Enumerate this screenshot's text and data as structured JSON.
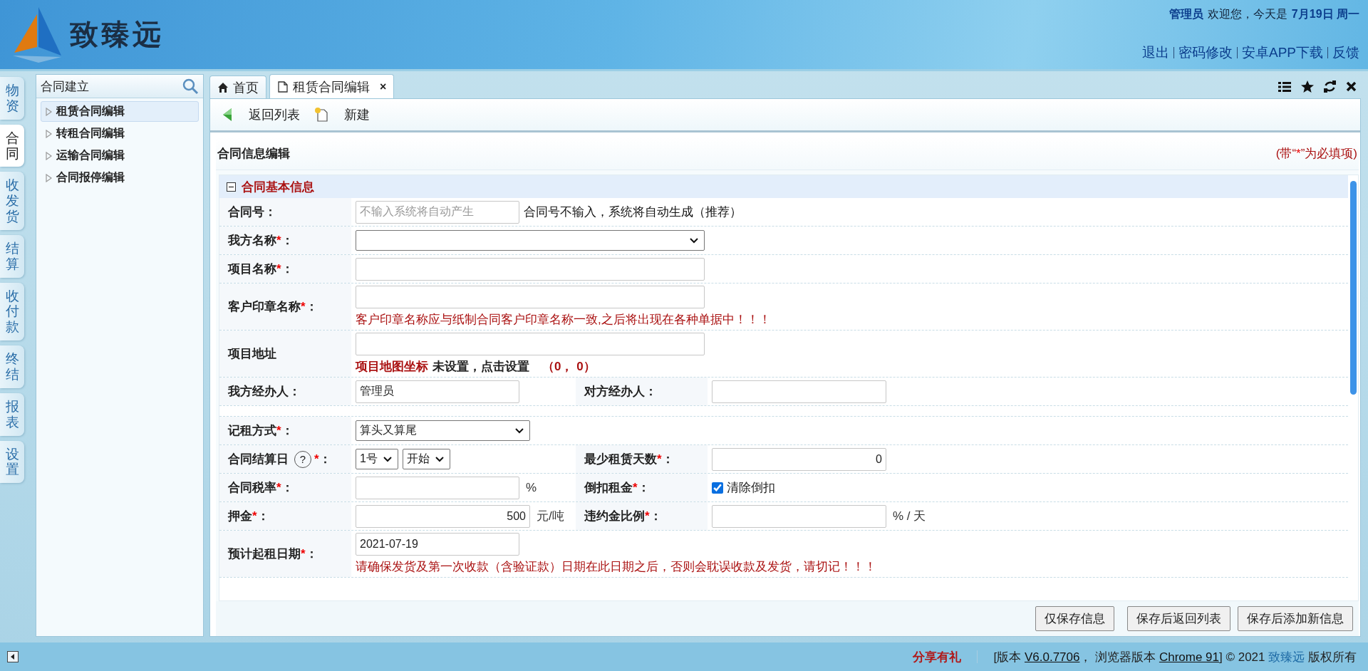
{
  "header": {
    "logo": "致臻远",
    "user": "管理员",
    "greeting": "欢迎您，今天是",
    "date": "7月19日 周一",
    "links": [
      "退出",
      "密码修改",
      "安卓APP下载",
      "反馈"
    ]
  },
  "module_tabs": [
    {
      "label": "物资",
      "selected": false
    },
    {
      "label": "合同",
      "selected": true
    },
    {
      "label": "收发货",
      "selected": false
    },
    {
      "label": "结算",
      "selected": false
    },
    {
      "label": "收付款",
      "selected": false
    },
    {
      "label": "终结",
      "selected": false
    },
    {
      "label": "报表",
      "selected": false
    },
    {
      "label": "设置",
      "selected": false
    }
  ],
  "sidebar": {
    "search": {
      "value": "合同建立"
    },
    "items": [
      {
        "label": "租赁合同编辑",
        "selected": true
      },
      {
        "label": "转租合同编辑",
        "selected": false
      },
      {
        "label": "运输合同编辑",
        "selected": false
      },
      {
        "label": "合同报停编辑",
        "selected": false
      }
    ]
  },
  "tabs": [
    {
      "label": "首页",
      "kind": "home",
      "selected": false
    },
    {
      "label": "租赁合同编辑",
      "kind": "page",
      "selected": true,
      "close": "×"
    }
  ],
  "toolbar": [
    {
      "label": "返回列表",
      "kind": "back"
    },
    {
      "label": "新建",
      "kind": "new"
    }
  ],
  "form": {
    "title": "合同信息编辑",
    "note": {
      "before": "(带“",
      "mark": "*",
      "after": "”为必填项)"
    },
    "section": {
      "title": "合同基本信息",
      "expanded": true
    },
    "rows": [
      {
        "cells": [
          {
            "label": "合同号",
            "suffix": "：",
            "controls": [
              {
                "kind": "input",
                "placeholder": "不输入系统将自动产生"
              }
            ],
            "after": [
              {
                "kind": "hint",
                "text": "合同号不输入，系统将自动生成（推荐）"
              }
            ]
          }
        ]
      },
      {
        "cells": [
          {
            "label": "我方名称",
            "mark": "*",
            "suffix": "：",
            "controls": [
              {
                "kind": "select"
              }
            ]
          }
        ]
      },
      {
        "cells": [
          {
            "label": "项目名称",
            "mark": "*",
            "suffix": "：",
            "controls": [
              {
                "kind": "input"
              }
            ]
          }
        ]
      },
      {
        "cells": [
          {
            "label": "客户印章名称",
            "mark": "*",
            "suffix": "：",
            "controls": [
              {
                "kind": "input"
              }
            ],
            "below": [
              {
                "kind": "warning",
                "text": "客户印章名称应与纸制合同客户印章名称一致,之后将出现在各种单据中！！！"
              }
            ]
          }
        ]
      },
      {
        "cells": [
          {
            "label": "项目地址",
            "controls": [
              {
                "kind": "input"
              }
            ],
            "below": [
              {
                "kind": "map-link",
                "text": "项目地图坐标"
              },
              {
                "kind": "status",
                "text": "未设置，点击设置"
              },
              {
                "kind": "coords",
                "text": "（0， 0）"
              }
            ]
          }
        ]
      },
      {
        "cells": [
          {
            "label": "我方经办人",
            "suffix": "：",
            "controls": [
              {
                "kind": "input",
                "value": "管理员"
              }
            ]
          },
          {
            "label": "对方经办人",
            "suffix": "：",
            "controls": [
              {
                "kind": "input"
              }
            ]
          }
        ]
      },
      {
        "cells": [
          {
            "label": "记租方式",
            "mark": "*",
            "suffix": "：",
            "controls": [
              {
                "kind": "select",
                "value": "算头又算尾"
              }
            ]
          }
        ]
      },
      {
        "cells": [
          {
            "label": "合同结算日",
            "help": "?",
            "mark": "*",
            "suffix": "：",
            "controls": [
              {
                "kind": "select",
                "value": "1号"
              },
              {
                "kind": "select",
                "value": "开始"
              }
            ]
          },
          {
            "label": "最少租赁天数",
            "mark": "*",
            "suffix": "：",
            "controls": [
              {
                "kind": "number",
                "value": "0"
              }
            ]
          }
        ]
      },
      {
        "cells": [
          {
            "label": "合同税率",
            "mark": "*",
            "suffix": "：",
            "controls": [
              {
                "kind": "input"
              }
            ],
            "after": [
              {
                "kind": "unit",
                "text": "%"
              }
            ]
          },
          {
            "label": "倒扣租金",
            "mark": "*",
            "suffix": "：",
            "controls": [
              {
                "kind": "checkbox",
                "checked": true,
                "label": "清除倒扣"
              }
            ]
          }
        ]
      },
      {
        "cells": [
          {
            "label": "押金",
            "mark": "*",
            "suffix": "：",
            "controls": [
              {
                "kind": "number",
                "value": "500"
              }
            ],
            "after": [
              {
                "kind": "unit",
                "text": "元/吨"
              }
            ]
          },
          {
            "label": "违约金比例",
            "mark": "*",
            "suffix": "：",
            "controls": [
              {
                "kind": "input"
              }
            ],
            "after": [
              {
                "kind": "unit",
                "text": "% / 天"
              }
            ]
          }
        ]
      },
      {
        "cells": [
          {
            "label": "预计起租日期",
            "mark": "*",
            "suffix": "：",
            "controls": [
              {
                "kind": "input",
                "value": "2021-07-19"
              }
            ],
            "below": [
              {
                "kind": "warning",
                "text": "请确保发货及第一次收款（含验证款）日期在此日期之后，否则会耽误收款及发货，请切记！！！"
              }
            ]
          }
        ]
      }
    ],
    "buttons": [
      "仅保存信息",
      "保存后返回列表",
      "保存后添加新信息"
    ]
  },
  "footer": {
    "share": "分享有礼",
    "notice": [
      {
        "kind": "text",
        "text": "[版本 "
      },
      {
        "kind": "link",
        "text": "V6.0.7706"
      },
      {
        "kind": "text",
        "text": "， 浏览器版本 "
      },
      {
        "kind": "link",
        "text": "Chrome 91"
      },
      {
        "kind": "text",
        "text": "] © 2021 "
      },
      {
        "kind": "brand",
        "text": "致臻远"
      },
      {
        "kind": "text",
        "text": " 版权所有"
      }
    ]
  }
}
